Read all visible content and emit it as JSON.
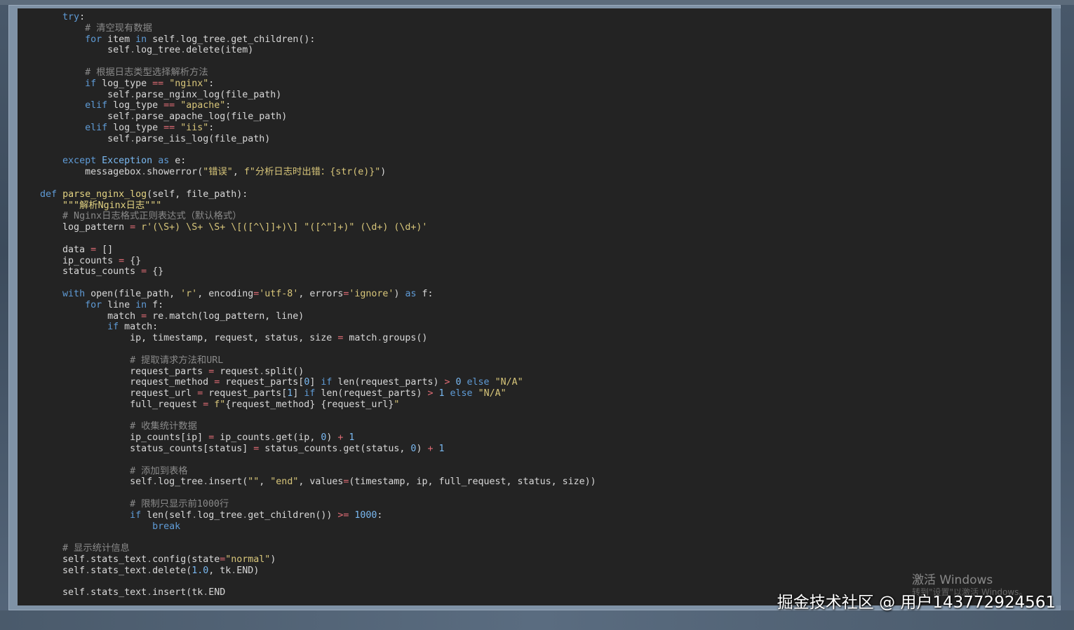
{
  "colors": {
    "editor_bg": "#232323",
    "keyword": "#5f9bd6",
    "string": "#d8c67a",
    "comment": "#8a8a8a",
    "number": "#79b8f0",
    "operator": "#e06c75",
    "plain": "#d8d8d8"
  },
  "code_lines": [
    [
      [
        "t-plain",
        "        "
      ],
      [
        "t-kw",
        "try"
      ],
      [
        "t-plain",
        ":"
      ]
    ],
    [
      [
        "t-plain",
        "            "
      ],
      [
        "t-cmt",
        "# 清空现有数据"
      ]
    ],
    [
      [
        "t-plain",
        "            "
      ],
      [
        "t-kw",
        "for"
      ],
      [
        "t-plain",
        " item "
      ],
      [
        "t-kw",
        "in"
      ],
      [
        "t-plain",
        " self"
      ],
      [
        "t-dot",
        "."
      ],
      [
        "t-plain",
        "log_tree"
      ],
      [
        "t-dot",
        "."
      ],
      [
        "t-plain",
        "get_children():"
      ]
    ],
    [
      [
        "t-plain",
        "                self"
      ],
      [
        "t-dot",
        "."
      ],
      [
        "t-plain",
        "log_tree"
      ],
      [
        "t-dot",
        "."
      ],
      [
        "t-plain",
        "delete(item)"
      ]
    ],
    [],
    [
      [
        "t-plain",
        "            "
      ],
      [
        "t-cmt",
        "# 根据日志类型选择解析方法"
      ]
    ],
    [
      [
        "t-plain",
        "            "
      ],
      [
        "t-kw",
        "if"
      ],
      [
        "t-plain",
        " log_type "
      ],
      [
        "t-op",
        "=="
      ],
      [
        "t-plain",
        " "
      ],
      [
        "t-str",
        "\"nginx\""
      ],
      [
        "t-plain",
        ":"
      ]
    ],
    [
      [
        "t-plain",
        "                self"
      ],
      [
        "t-dot",
        "."
      ],
      [
        "t-plain",
        "parse_nginx_log(file_path)"
      ]
    ],
    [
      [
        "t-plain",
        "            "
      ],
      [
        "t-kw",
        "elif"
      ],
      [
        "t-plain",
        " log_type "
      ],
      [
        "t-op",
        "=="
      ],
      [
        "t-plain",
        " "
      ],
      [
        "t-str",
        "\"apache\""
      ],
      [
        "t-plain",
        ":"
      ]
    ],
    [
      [
        "t-plain",
        "                self"
      ],
      [
        "t-dot",
        "."
      ],
      [
        "t-plain",
        "parse_apache_log(file_path)"
      ]
    ],
    [
      [
        "t-plain",
        "            "
      ],
      [
        "t-kw",
        "elif"
      ],
      [
        "t-plain",
        " log_type "
      ],
      [
        "t-op",
        "=="
      ],
      [
        "t-plain",
        " "
      ],
      [
        "t-str",
        "\"iis\""
      ],
      [
        "t-plain",
        ":"
      ]
    ],
    [
      [
        "t-plain",
        "                self"
      ],
      [
        "t-dot",
        "."
      ],
      [
        "t-plain",
        "parse_iis_log(file_path)"
      ]
    ],
    [],
    [
      [
        "t-plain",
        "        "
      ],
      [
        "t-kw",
        "except"
      ],
      [
        "t-plain",
        " "
      ],
      [
        "t-cls",
        "Exception"
      ],
      [
        "t-plain",
        " "
      ],
      [
        "t-kw",
        "as"
      ],
      [
        "t-plain",
        " e:"
      ]
    ],
    [
      [
        "t-plain",
        "            messagebox"
      ],
      [
        "t-dot",
        "."
      ],
      [
        "t-plain",
        "showerror("
      ],
      [
        "t-str",
        "\"错误\""
      ],
      [
        "t-plain",
        ", "
      ],
      [
        "t-str",
        "f\"分析日志时出错：{str(e)}\""
      ],
      [
        "t-plain",
        ")"
      ]
    ],
    [],
    [
      [
        "t-plain",
        "    "
      ],
      [
        "t-kw",
        "def"
      ],
      [
        "t-plain",
        " "
      ],
      [
        "t-fn",
        "parse_nginx_log"
      ],
      [
        "t-plain",
        "(self, file_path):"
      ]
    ],
    [
      [
        "t-plain",
        "        "
      ],
      [
        "t-doc",
        "\"\"\"解析Nginx日志\"\"\""
      ]
    ],
    [
      [
        "t-plain",
        "        "
      ],
      [
        "t-cmt",
        "# Nginx日志格式正则表达式（默认格式）"
      ]
    ],
    [
      [
        "t-plain",
        "        log_pattern "
      ],
      [
        "t-op",
        "="
      ],
      [
        "t-plain",
        " "
      ],
      [
        "t-str",
        "r'(\\S+) \\S+ \\S+ \\[([^\\]]+)\\] \"([^\"]+)\" (\\d+) (\\d+)'"
      ]
    ],
    [],
    [
      [
        "t-plain",
        "        data "
      ],
      [
        "t-op",
        "="
      ],
      [
        "t-plain",
        " []"
      ]
    ],
    [
      [
        "t-plain",
        "        ip_counts "
      ],
      [
        "t-op",
        "="
      ],
      [
        "t-plain",
        " {}"
      ]
    ],
    [
      [
        "t-plain",
        "        status_counts "
      ],
      [
        "t-op",
        "="
      ],
      [
        "t-plain",
        " {}"
      ]
    ],
    [],
    [
      [
        "t-plain",
        "        "
      ],
      [
        "t-kw",
        "with"
      ],
      [
        "t-plain",
        " open(file_path, "
      ],
      [
        "t-str",
        "'r'"
      ],
      [
        "t-plain",
        ", encoding"
      ],
      [
        "t-op",
        "="
      ],
      [
        "t-str",
        "'utf-8'"
      ],
      [
        "t-plain",
        ", errors"
      ],
      [
        "t-op",
        "="
      ],
      [
        "t-str",
        "'ignore'"
      ],
      [
        "t-plain",
        ") "
      ],
      [
        "t-kw",
        "as"
      ],
      [
        "t-plain",
        " f:"
      ]
    ],
    [
      [
        "t-plain",
        "            "
      ],
      [
        "t-kw",
        "for"
      ],
      [
        "t-plain",
        " line "
      ],
      [
        "t-kw",
        "in"
      ],
      [
        "t-plain",
        " f:"
      ]
    ],
    [
      [
        "t-plain",
        "                match "
      ],
      [
        "t-op",
        "="
      ],
      [
        "t-plain",
        " re"
      ],
      [
        "t-dot",
        "."
      ],
      [
        "t-plain",
        "match(log_pattern, line)"
      ]
    ],
    [
      [
        "t-plain",
        "                "
      ],
      [
        "t-kw",
        "if"
      ],
      [
        "t-plain",
        " match:"
      ]
    ],
    [
      [
        "t-plain",
        "                    ip, timestamp, request, status, size "
      ],
      [
        "t-op",
        "="
      ],
      [
        "t-plain",
        " match"
      ],
      [
        "t-dot",
        "."
      ],
      [
        "t-plain",
        "groups()"
      ]
    ],
    [],
    [
      [
        "t-plain",
        "                    "
      ],
      [
        "t-cmt",
        "# 提取请求方法和URL"
      ]
    ],
    [
      [
        "t-plain",
        "                    request_parts "
      ],
      [
        "t-op",
        "="
      ],
      [
        "t-plain",
        " request"
      ],
      [
        "t-dot",
        "."
      ],
      [
        "t-plain",
        "split()"
      ]
    ],
    [
      [
        "t-plain",
        "                    request_method "
      ],
      [
        "t-op",
        "="
      ],
      [
        "t-plain",
        " request_parts["
      ],
      [
        "t-num",
        "0"
      ],
      [
        "t-plain",
        "] "
      ],
      [
        "t-kw",
        "if"
      ],
      [
        "t-plain",
        " len(request_parts) "
      ],
      [
        "t-op",
        ">"
      ],
      [
        "t-plain",
        " "
      ],
      [
        "t-num",
        "0"
      ],
      [
        "t-plain",
        " "
      ],
      [
        "t-kw",
        "else"
      ],
      [
        "t-plain",
        " "
      ],
      [
        "t-str",
        "\"N/A\""
      ]
    ],
    [
      [
        "t-plain",
        "                    request_url "
      ],
      [
        "t-op",
        "="
      ],
      [
        "t-plain",
        " request_parts["
      ],
      [
        "t-num",
        "1"
      ],
      [
        "t-plain",
        "] "
      ],
      [
        "t-kw",
        "if"
      ],
      [
        "t-plain",
        " len(request_parts) "
      ],
      [
        "t-op",
        ">"
      ],
      [
        "t-plain",
        " "
      ],
      [
        "t-num",
        "1"
      ],
      [
        "t-plain",
        " "
      ],
      [
        "t-kw",
        "else"
      ],
      [
        "t-plain",
        " "
      ],
      [
        "t-str",
        "\"N/A\""
      ]
    ],
    [
      [
        "t-plain",
        "                    full_request "
      ],
      [
        "t-op",
        "="
      ],
      [
        "t-plain",
        " "
      ],
      [
        "t-str",
        "f\""
      ],
      [
        "t-plain",
        "{request_method} {request_url}"
      ],
      [
        "t-str",
        "\""
      ]
    ],
    [],
    [
      [
        "t-plain",
        "                    "
      ],
      [
        "t-cmt",
        "# 收集统计数据"
      ]
    ],
    [
      [
        "t-plain",
        "                    ip_counts[ip] "
      ],
      [
        "t-op",
        "="
      ],
      [
        "t-plain",
        " ip_counts"
      ],
      [
        "t-dot",
        "."
      ],
      [
        "t-plain",
        "get(ip, "
      ],
      [
        "t-num",
        "0"
      ],
      [
        "t-plain",
        ") "
      ],
      [
        "t-op",
        "+"
      ],
      [
        "t-plain",
        " "
      ],
      [
        "t-num",
        "1"
      ]
    ],
    [
      [
        "t-plain",
        "                    status_counts[status] "
      ],
      [
        "t-op",
        "="
      ],
      [
        "t-plain",
        " status_counts"
      ],
      [
        "t-dot",
        "."
      ],
      [
        "t-plain",
        "get(status, "
      ],
      [
        "t-num",
        "0"
      ],
      [
        "t-plain",
        ") "
      ],
      [
        "t-op",
        "+"
      ],
      [
        "t-plain",
        " "
      ],
      [
        "t-num",
        "1"
      ]
    ],
    [],
    [
      [
        "t-plain",
        "                    "
      ],
      [
        "t-cmt",
        "# 添加到表格"
      ]
    ],
    [
      [
        "t-plain",
        "                    self"
      ],
      [
        "t-dot",
        "."
      ],
      [
        "t-plain",
        "log_tree"
      ],
      [
        "t-dot",
        "."
      ],
      [
        "t-plain",
        "insert("
      ],
      [
        "t-str",
        "\"\""
      ],
      [
        "t-plain",
        ", "
      ],
      [
        "t-str",
        "\"end\""
      ],
      [
        "t-plain",
        ", values"
      ],
      [
        "t-op",
        "="
      ],
      [
        "t-plain",
        "(timestamp, ip, full_request, status, size))"
      ]
    ],
    [],
    [
      [
        "t-plain",
        "                    "
      ],
      [
        "t-cmt",
        "# 限制只显示前1000行"
      ]
    ],
    [
      [
        "t-plain",
        "                    "
      ],
      [
        "t-kw",
        "if"
      ],
      [
        "t-plain",
        " len(self"
      ],
      [
        "t-dot",
        "."
      ],
      [
        "t-plain",
        "log_tree"
      ],
      [
        "t-dot",
        "."
      ],
      [
        "t-plain",
        "get_children()) "
      ],
      [
        "t-op",
        ">="
      ],
      [
        "t-plain",
        " "
      ],
      [
        "t-num",
        "1000"
      ],
      [
        "t-plain",
        ":"
      ]
    ],
    [
      [
        "t-plain",
        "                        "
      ],
      [
        "t-kw",
        "break"
      ]
    ],
    [],
    [
      [
        "t-plain",
        "        "
      ],
      [
        "t-cmt",
        "# 显示统计信息"
      ]
    ],
    [
      [
        "t-plain",
        "        self"
      ],
      [
        "t-dot",
        "."
      ],
      [
        "t-plain",
        "stats_text"
      ],
      [
        "t-dot",
        "."
      ],
      [
        "t-plain",
        "config(state"
      ],
      [
        "t-op",
        "="
      ],
      [
        "t-str",
        "\"normal\""
      ],
      [
        "t-plain",
        ")"
      ]
    ],
    [
      [
        "t-plain",
        "        self"
      ],
      [
        "t-dot",
        "."
      ],
      [
        "t-plain",
        "stats_text"
      ],
      [
        "t-dot",
        "."
      ],
      [
        "t-plain",
        "delete("
      ],
      [
        "t-num",
        "1.0"
      ],
      [
        "t-plain",
        ", tk"
      ],
      [
        "t-dot",
        "."
      ],
      [
        "t-plain",
        "END)"
      ]
    ],
    [],
    [
      [
        "t-plain",
        "        self"
      ],
      [
        "t-dot",
        "."
      ],
      [
        "t-plain",
        "stats_text"
      ],
      [
        "t-dot",
        "."
      ],
      [
        "t-plain",
        "insert(tk"
      ],
      [
        "t-dot",
        "."
      ],
      [
        "t-plain",
        "END"
      ]
    ]
  ],
  "watermark": {
    "title": "激活 Windows",
    "subtitle": "转到\"设置\"以激活 Windows。"
  },
  "credit": "掘金技术社区 @ 用户143772924561"
}
